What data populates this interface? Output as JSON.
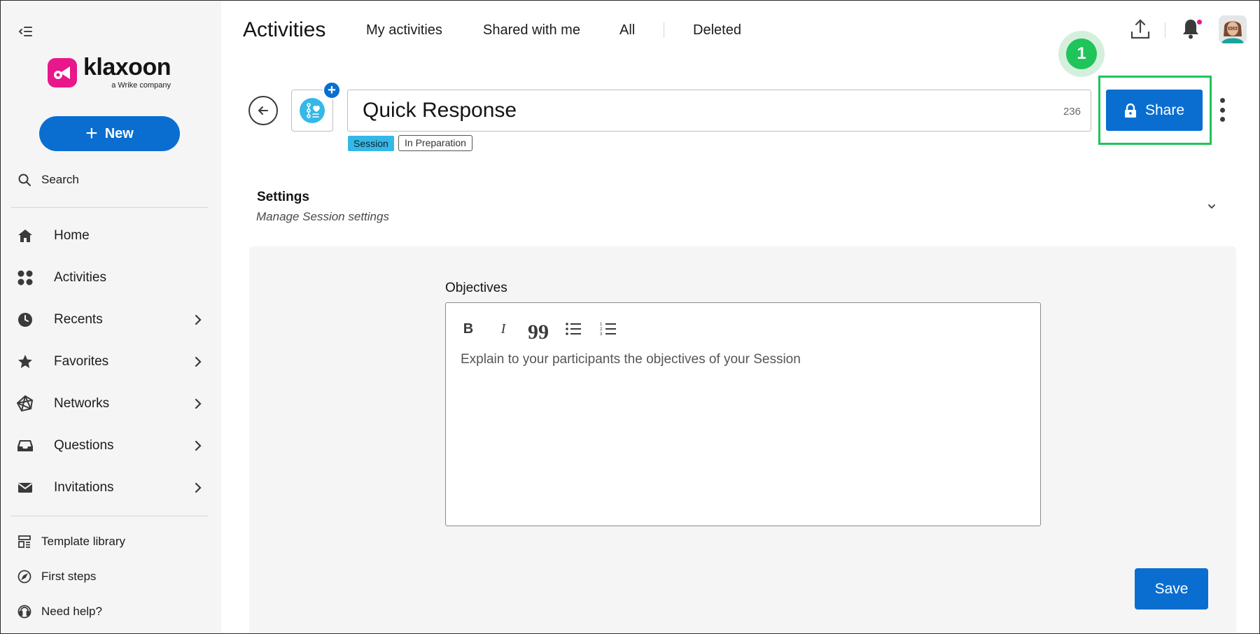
{
  "sidebar": {
    "logo": {
      "word": "klaxoon",
      "sub": "a Wrike company",
      "brand_color": "#e8178a"
    },
    "new_button": {
      "label": "New",
      "icon": "plus-icon"
    },
    "search": {
      "label": "Search",
      "icon": "search-icon"
    },
    "nav": [
      {
        "label": "Home",
        "icon": "home-icon",
        "has_submenu": false
      },
      {
        "label": "Activities",
        "icon": "activities-grid-icon",
        "has_submenu": false
      },
      {
        "label": "Recents",
        "icon": "clock-icon",
        "has_submenu": true
      },
      {
        "label": "Favorites",
        "icon": "star-icon",
        "has_submenu": true
      },
      {
        "label": "Networks",
        "icon": "network-icon",
        "has_submenu": true
      },
      {
        "label": "Questions",
        "icon": "inbox-icon",
        "has_submenu": true
      },
      {
        "label": "Invitations",
        "icon": "envelope-icon",
        "has_submenu": true
      }
    ],
    "footer": [
      {
        "label": "Template library",
        "icon": "template-icon"
      },
      {
        "label": "First steps",
        "icon": "compass-icon"
      },
      {
        "label": "Need help?",
        "icon": "help-headset-icon"
      }
    ]
  },
  "topbar": {
    "title": "Activities",
    "tabs": [
      "My activities",
      "Shared with me",
      "All",
      "Deleted"
    ]
  },
  "activity": {
    "title": "Quick Response",
    "char_count": "236",
    "tags": {
      "type": "Session",
      "status": "In Preparation"
    },
    "share_label": "Share",
    "step_number": "1"
  },
  "settings": {
    "title": "Settings",
    "subtitle": "Manage Session settings"
  },
  "objectives": {
    "label": "Objectives",
    "placeholder": "Explain to your participants the objectives of your Session",
    "toolbar": {
      "bold": "B",
      "italic": "I",
      "quote": "99"
    }
  },
  "save_label": "Save",
  "colors": {
    "primary": "#0a6ed1",
    "highlight": "#1fc45a",
    "session_tag": "#35b8e8",
    "brand": "#e8178a"
  }
}
